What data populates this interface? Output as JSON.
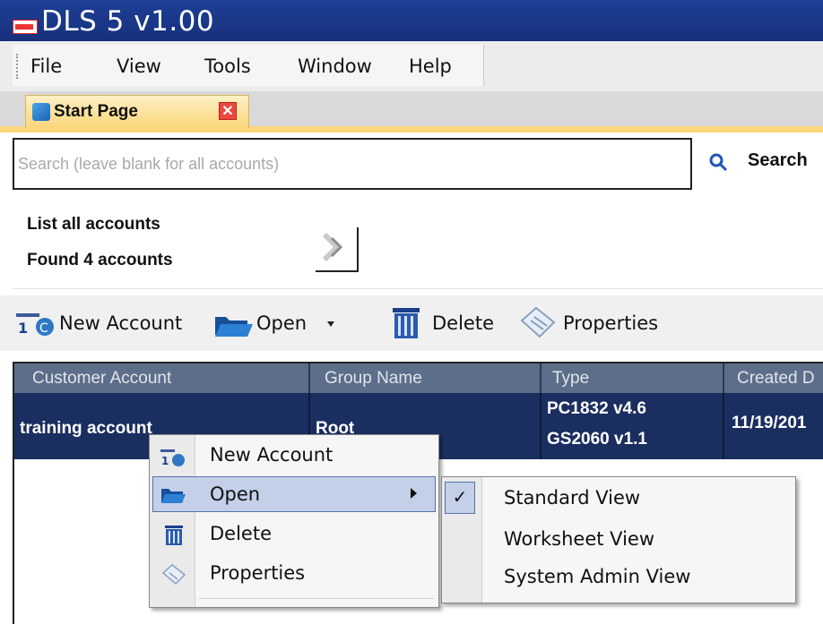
{
  "window": {
    "title": "DLS 5 v1.00"
  },
  "menu": {
    "items": [
      "File",
      "View",
      "Tools",
      "Window",
      "Help"
    ]
  },
  "tabs": {
    "start_page": "Start Page"
  },
  "search": {
    "placeholder": "Search (leave blank for all accounts)",
    "value": "",
    "button_label": "Search"
  },
  "status": {
    "list_all": "List all accounts",
    "found": "Found 4 accounts"
  },
  "toolbar": {
    "new_account": "New Account",
    "open": "Open",
    "delete": "Delete",
    "properties": "Properties"
  },
  "grid": {
    "columns": [
      "Customer Account",
      "Group Name",
      "Type",
      "Created D"
    ],
    "rows": [
      {
        "account": "training account",
        "group": "Root",
        "type_line1": "PC1832 v4.6",
        "type_line2": "GS2060 v1.1",
        "created": "11/19/201"
      }
    ]
  },
  "context_menu": {
    "items": [
      "New Account",
      "Open",
      "Delete",
      "Properties"
    ],
    "open_submenu": [
      "Standard View",
      "Worksheet View",
      "System Admin View"
    ],
    "checked_submenu_item": "Standard View"
  },
  "colors": {
    "title_bar": "#1e3f95",
    "tab_active": "#fbd67a",
    "grid_header": "#5c6e8a",
    "selected_row": "#1a2e60",
    "menu_highlight": "#c3d0e8"
  },
  "icons": [
    "app-logo-icon",
    "start-page-icon",
    "close-icon",
    "search-icon",
    "go-arrow-icon",
    "new-account-icon",
    "folder-open-icon",
    "dropdown-arrow-icon",
    "trash-icon",
    "properties-icon",
    "submenu-arrow-icon",
    "checkmark-icon"
  ]
}
